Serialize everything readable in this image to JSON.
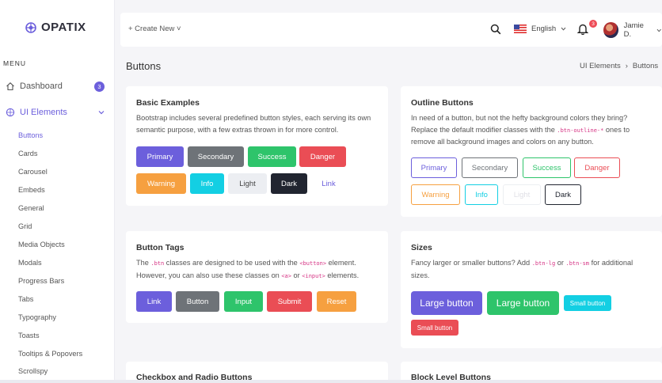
{
  "brand": {
    "name": "OPATIX"
  },
  "sidebar": {
    "menu_label": "MENU",
    "dashboard": {
      "label": "Dashboard",
      "badge": "3"
    },
    "ui_elements": {
      "label": "UI Elements"
    },
    "sub_items": [
      "Buttons",
      "Cards",
      "Carousel",
      "Embeds",
      "General",
      "Grid",
      "Media Objects",
      "Modals",
      "Progress Bars",
      "Tabs",
      "Typography",
      "Toasts",
      "Tooltips & Popovers",
      "Scrollspy"
    ]
  },
  "header": {
    "create_new": "+ Create New ˅",
    "language": "English",
    "notifications_count": "3",
    "user_name": "Jamie D."
  },
  "page": {
    "title": "Buttons",
    "breadcrumb": [
      "UI Elements",
      "Buttons"
    ]
  },
  "cards": {
    "basic": {
      "title": "Basic Examples",
      "text": "Bootstrap includes several predefined button styles, each serving its own semantic purpose, with a few extras thrown in for more control.",
      "buttons": [
        "Primary",
        "Secondary",
        "Success",
        "Danger",
        "Warning",
        "Info",
        "Light",
        "Dark",
        "Link"
      ]
    },
    "outline": {
      "title": "Outline Buttons",
      "text_1": "In need of a button, but not the hefty background colors they bring? Replace the default modifier classes with the ",
      "code": ".btn-outline-*",
      "text_2": " ones to remove all background images and colors on any button.",
      "buttons": [
        "Primary",
        "Secondary",
        "Success",
        "Danger",
        "Warning",
        "Info",
        "Light",
        "Dark"
      ]
    },
    "tags": {
      "title": "Button Tags",
      "text_1": "The ",
      "code_1": ".btn",
      "text_2": " classes are designed to be used with the ",
      "code_2": "<button>",
      "text_3": " element. However, you can also use these classes on ",
      "code_3": "<a>",
      "text_4": " or ",
      "code_4": "<input>",
      "text_5": " elements.",
      "buttons": [
        "Link",
        "Button",
        "Input",
        "Submit",
        "Reset"
      ]
    },
    "sizes": {
      "title": "Sizes",
      "text_1": "Fancy larger or smaller buttons? Add ",
      "code_1": ".btn-lg",
      "text_2": " or ",
      "code_2": ".btn-sm",
      "text_3": " for additional sizes.",
      "buttons": [
        "Large button",
        "Large button",
        "Small button",
        "Small button"
      ]
    },
    "checkbox": {
      "title": "Checkbox and Radio Buttons"
    },
    "block": {
      "title": "Block Level Buttons"
    }
  },
  "colors": {
    "primary": "#6c5fdc",
    "secondary": "#6e7378",
    "success": "#2ec46b",
    "danger": "#ea4d55",
    "warning": "#f6a040",
    "info": "#13cfe3",
    "light": "#eceef2",
    "dark": "#212530"
  }
}
